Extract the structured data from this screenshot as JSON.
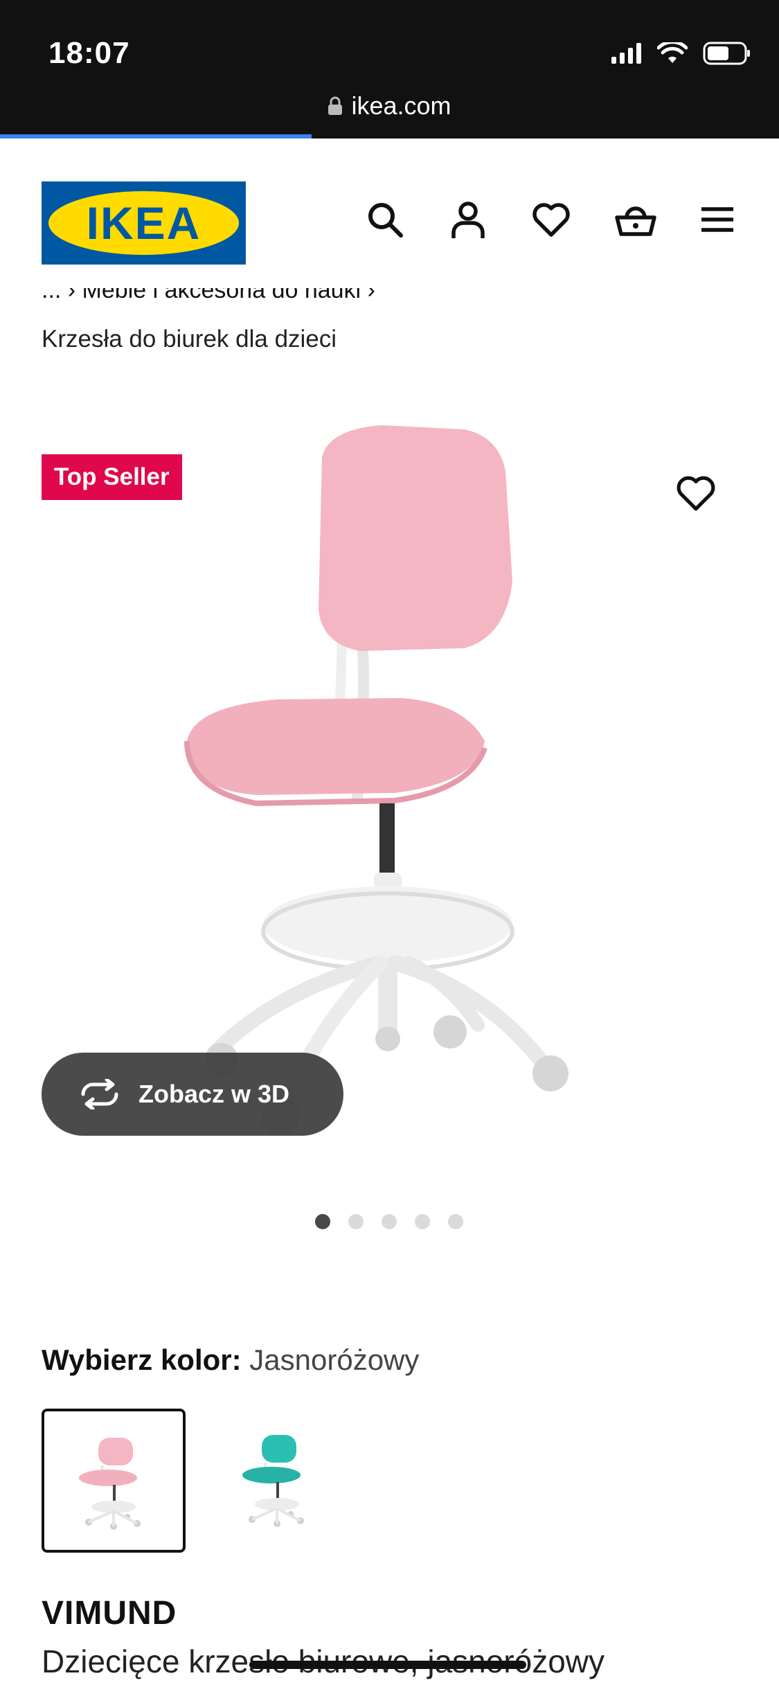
{
  "status_bar": {
    "time": "18:07",
    "url": "ikea.com",
    "load_progress": 0.4
  },
  "header": {
    "logo_text": "IKEA"
  },
  "breadcrumb": {
    "line1": "...  ›  Meble i akcesoria do nauki  ›",
    "current": "Krzesła do biurek dla dzieci"
  },
  "product_media": {
    "badge": "Top Seller",
    "view3d_label": "Zobacz w 3D",
    "slides_total": 5,
    "active_slide": 1
  },
  "color_select": {
    "label": "Wybierz kolor:",
    "selected": "Jasnoróżowy",
    "options": [
      "pink",
      "turquoise"
    ]
  },
  "product": {
    "name": "VIMUND",
    "description": "Dziecięce krzesło biurowe, jasnoróżowy"
  },
  "colors": {
    "ikea_blue": "#0058a3",
    "ikea_yellow": "#ffdb00",
    "badge_red": "#e0074d",
    "chair_pink": "#f4b6c2",
    "chair_teal": "#2bbfb3"
  },
  "icons": [
    "search-icon",
    "profile-icon",
    "heart-icon",
    "basket-icon",
    "menu-icon",
    "rotate-3d-icon",
    "lock-icon"
  ]
}
